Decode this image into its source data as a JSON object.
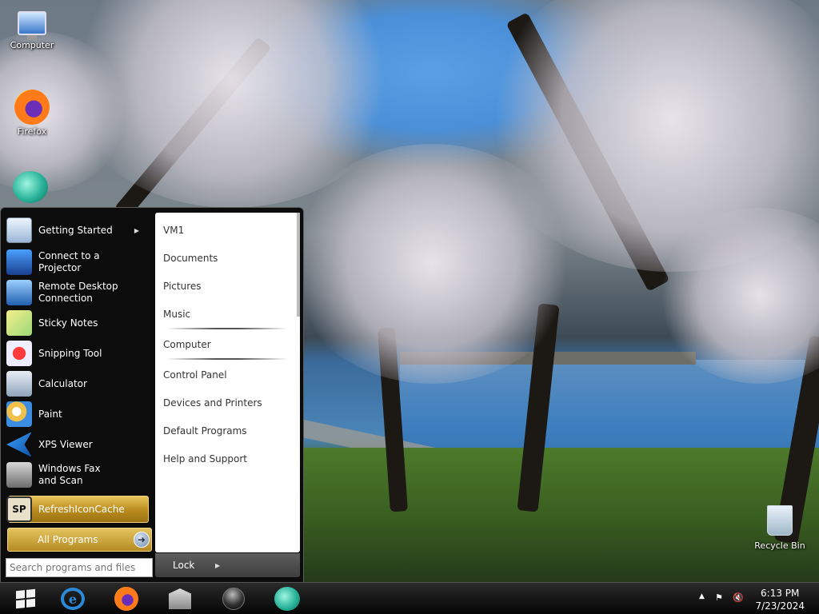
{
  "desktop": {
    "icons": [
      {
        "label": "Computer",
        "icon": "computer-icon"
      },
      {
        "label": "Firefox",
        "icon": "firefox-icon"
      },
      {
        "label": "",
        "icon": "app-orb-icon"
      },
      {
        "label": "Recycle Bin",
        "icon": "recycle-bin-icon"
      }
    ]
  },
  "start_menu": {
    "programs": [
      {
        "label": "Getting Started",
        "icon": "getting-started-icon",
        "has_submenu": true
      },
      {
        "label": "Connect to a Projector",
        "icon": "projector-icon"
      },
      {
        "label": "Remote Desktop Connection",
        "icon": "remote-desktop-icon"
      },
      {
        "label": "Sticky Notes",
        "icon": "sticky-notes-icon"
      },
      {
        "label": "Snipping Tool",
        "icon": "snipping-tool-icon"
      },
      {
        "label": "Calculator",
        "icon": "calculator-icon"
      },
      {
        "label": "Paint",
        "icon": "paint-icon"
      },
      {
        "label": "XPS Viewer",
        "icon": "xps-viewer-icon"
      },
      {
        "label": "Windows Fax and Scan",
        "icon": "fax-scan-icon"
      },
      {
        "label": "RefreshIconCache",
        "icon": "refresh-icon-cache-icon",
        "icon_text": "SP",
        "highlighted": true
      }
    ],
    "all_programs_label": "All Programs",
    "search_placeholder": "Search programs and files",
    "right_items": [
      {
        "label": "VM1"
      },
      {
        "label": "Documents"
      },
      {
        "label": "Pictures"
      },
      {
        "label": "Music"
      },
      {
        "label": "Computer"
      },
      {
        "label": "Control Panel"
      },
      {
        "label": "Devices and Printers"
      },
      {
        "label": "Default Programs"
      },
      {
        "label": "Help and Support"
      }
    ],
    "lock_label": "Lock"
  },
  "taskbar": {
    "pinned": [
      {
        "icon": "internet-explorer-icon",
        "glyph": "e"
      },
      {
        "icon": "firefox-icon"
      },
      {
        "icon": "library-icon"
      },
      {
        "icon": "media-ball-icon"
      },
      {
        "icon": "app-orb-icon"
      }
    ],
    "tray": {
      "time": "6:13 PM",
      "date": "7/23/2024",
      "icons": [
        "show-hidden-icons-icon",
        "action-center-flag-icon",
        "volume-muted-icon"
      ]
    }
  },
  "colors": {
    "highlight_gold": "#b98a1c",
    "menu_bg": "#0c0c0c",
    "taskbar_bg": "#050505"
  }
}
